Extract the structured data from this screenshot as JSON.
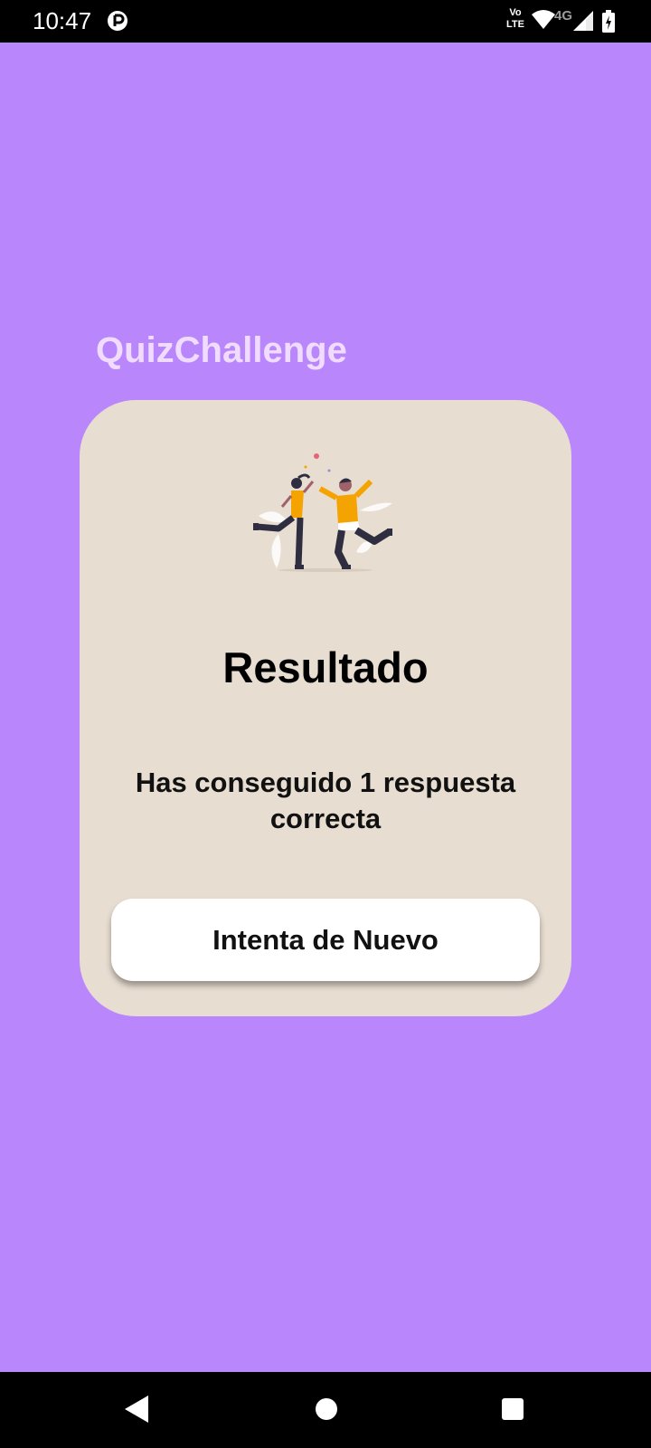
{
  "status_bar": {
    "time": "10:47",
    "volte_top": "Vo",
    "volte_bottom": "LTE",
    "network": "4G",
    "icons": [
      "app-notification-icon",
      "wifi-icon",
      "signal-icon",
      "battery-icon"
    ]
  },
  "app": {
    "title": "QuizChallenge"
  },
  "card": {
    "illustration": "people-celebrating-illustration",
    "title": "Resultado",
    "message": "Has conseguido 1 respuesta correcta",
    "retry_label": "Intenta de Nuevo"
  },
  "nav_bar": {
    "icons": [
      "back-icon",
      "home-icon",
      "recents-icon"
    ]
  },
  "colors": {
    "background": "#b987fb",
    "card": "#e8ddd1",
    "title": "#f0dcff",
    "button": "#ffffff",
    "accent_yellow": "#f4a300"
  }
}
